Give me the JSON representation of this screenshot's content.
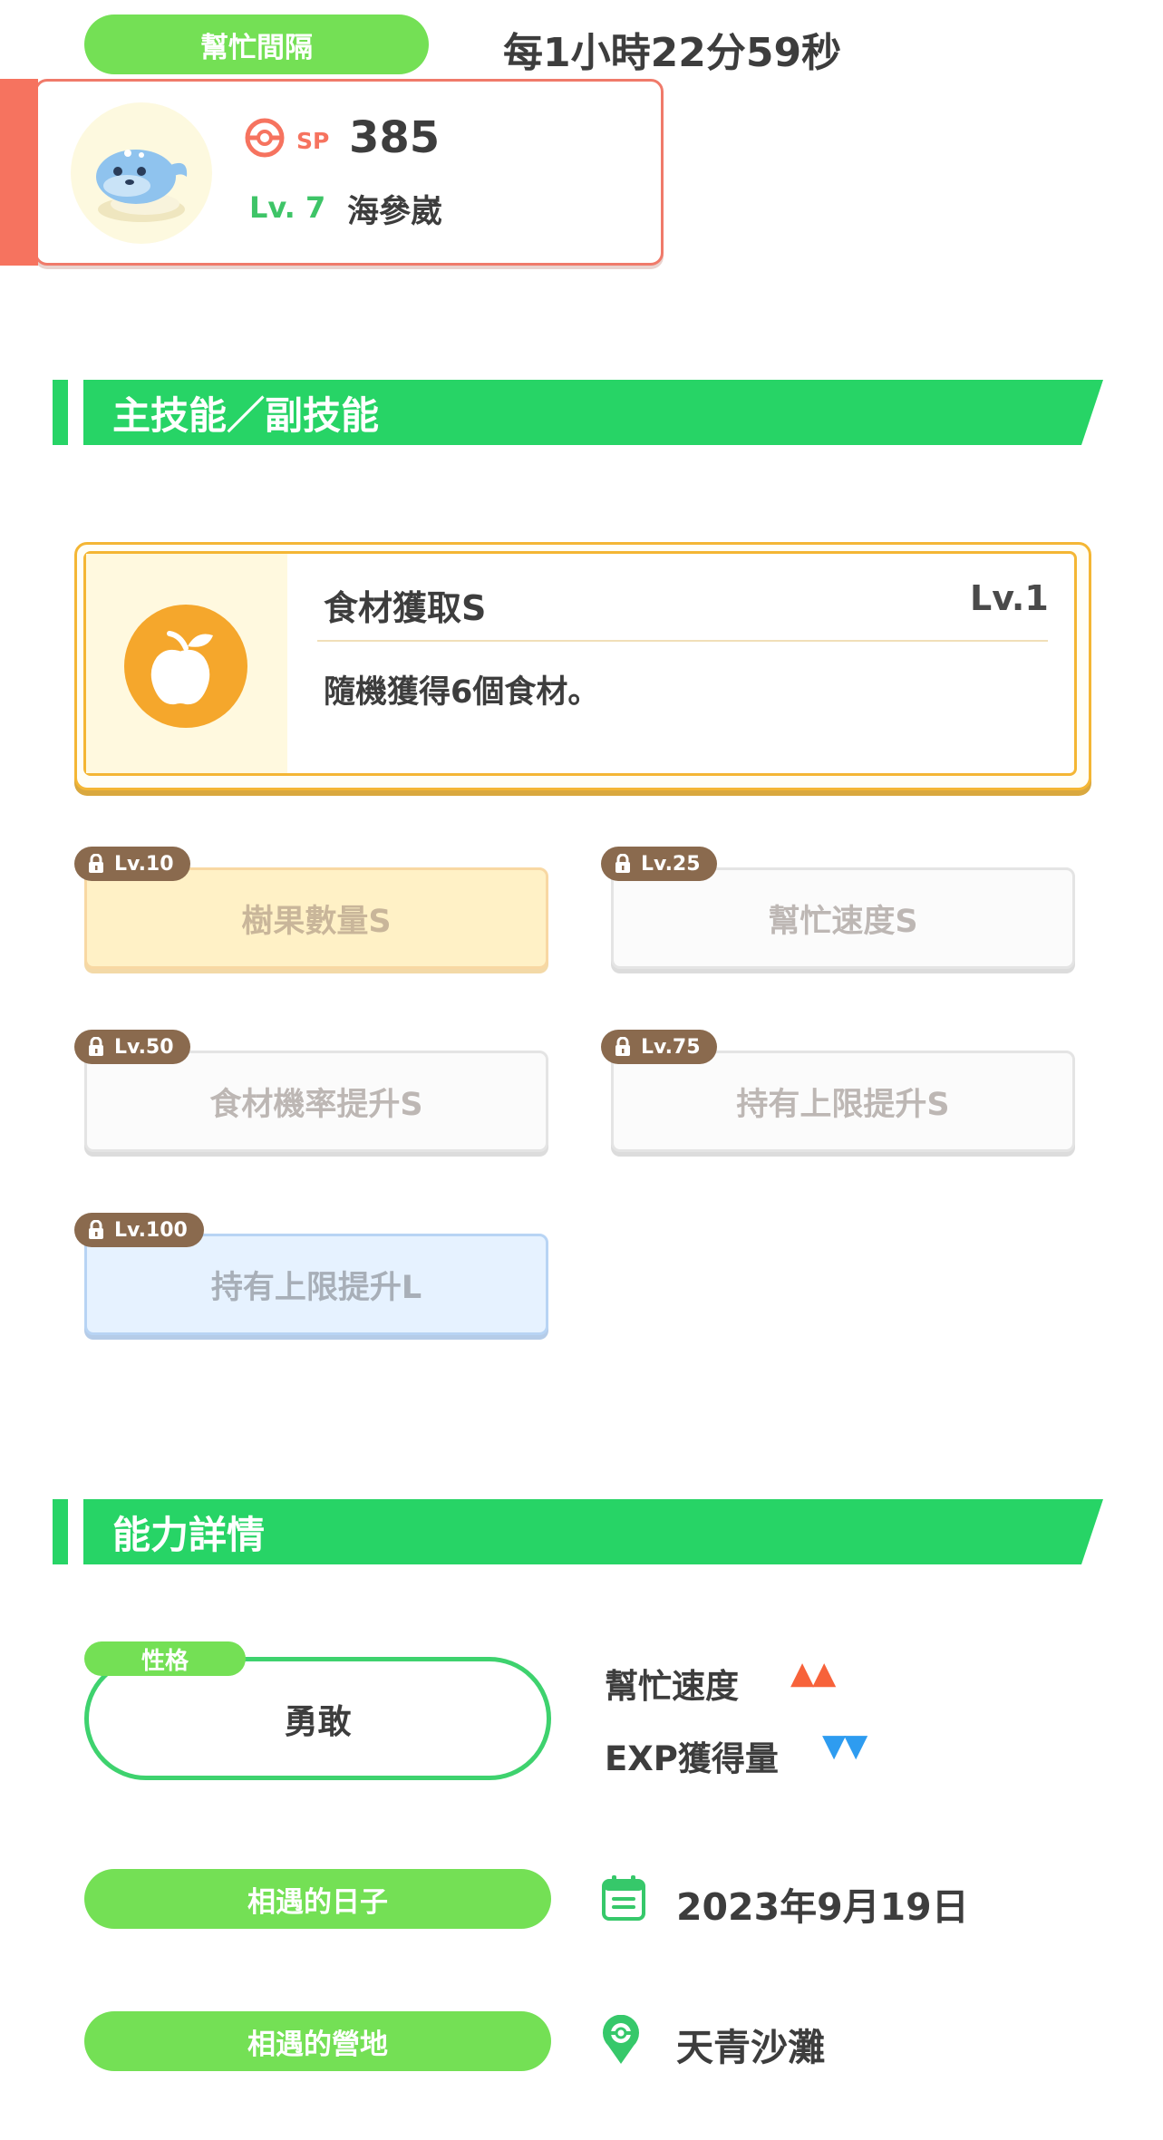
{
  "help_interval": {
    "label": "幫忙間隔",
    "value": "每1小時22分59秒"
  },
  "pokemon": {
    "sp_label": "SP",
    "sp_value": "385",
    "level": "Lv. 7",
    "name": "海參崴",
    "accent_color": "#f6735f"
  },
  "skills_section": {
    "title": "主技能／副技能"
  },
  "main_skill": {
    "name": "食材獲取S",
    "level": "Lv.1",
    "description": "隨機獲得6個食材。",
    "icon": "apple-icon",
    "color": "#f5a72c"
  },
  "sub_skills": [
    {
      "unlock": "Lv.10",
      "name": "樹果數量S",
      "tier": "gold"
    },
    {
      "unlock": "Lv.25",
      "name": "幫忙速度S",
      "tier": "white"
    },
    {
      "unlock": "Lv.50",
      "name": "食材機率提升S",
      "tier": "white"
    },
    {
      "unlock": "Lv.75",
      "name": "持有上限提升S",
      "tier": "white"
    },
    {
      "unlock": "Lv.100",
      "name": "持有上限提升L",
      "tier": "blue"
    }
  ],
  "ability_section": {
    "title": "能力詳情"
  },
  "nature": {
    "tag": "性格",
    "value": "勇敢",
    "up_label": "幫忙速度",
    "up_arrows": "▲▲",
    "up_color": "#f7623a",
    "down_label": "EXP獲得量",
    "down_arrows": "▼▼",
    "down_color": "#2e9cf0"
  },
  "meet_date": {
    "label": "相遇的日子",
    "value": "2023年9月19日",
    "icon": "calendar-icon"
  },
  "meet_place": {
    "label": "相遇的營地",
    "value": "天青沙灘",
    "icon": "location-pin-icon"
  }
}
